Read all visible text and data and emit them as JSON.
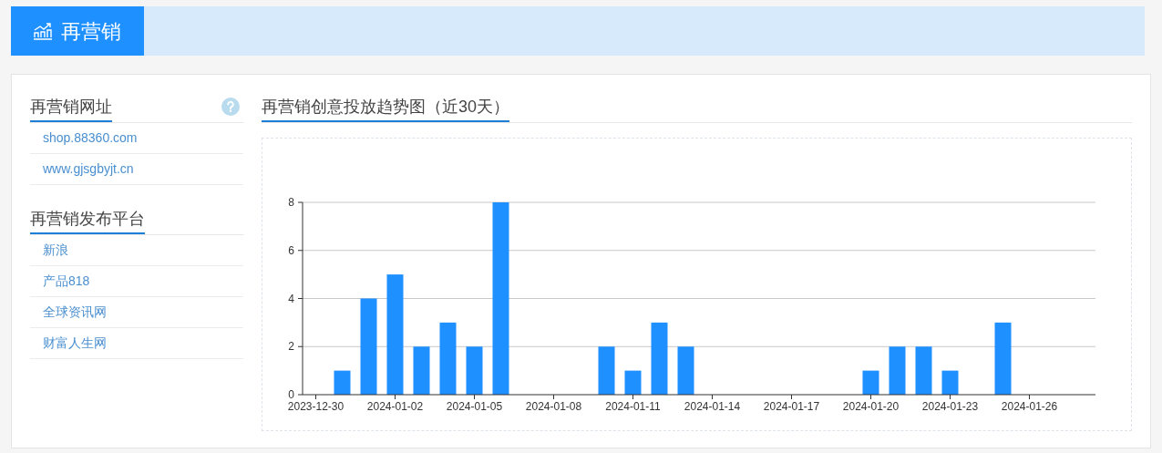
{
  "header": {
    "title": "再营销"
  },
  "sidebar": {
    "sections": [
      {
        "title": "再营销网址",
        "help": true,
        "items": [
          "shop.88360.com",
          "www.gjsgbyjt.cn"
        ]
      },
      {
        "title": "再营销发布平台",
        "help": false,
        "items": [
          "新浪",
          "产品818",
          "全球资讯网",
          "财富人生网"
        ]
      }
    ]
  },
  "chart_panel": {
    "title": "再营销创意投放趋势图（近30天）",
    "chart_data": {
      "type": "bar",
      "categories": [
        "2023-12-30",
        null,
        null,
        "2024-01-02",
        null,
        null,
        "2024-01-05",
        null,
        null,
        "2024-01-08",
        null,
        null,
        "2024-01-11",
        null,
        null,
        "2024-01-14",
        null,
        null,
        "2024-01-17",
        null,
        null,
        "2024-01-20",
        null,
        null,
        "2024-01-23",
        null,
        null,
        "2024-01-26",
        null,
        null
      ],
      "grid": true,
      "series": [
        {
          "color": "#1e90ff",
          "values": [
            0,
            1,
            4,
            5,
            2,
            3,
            2,
            8,
            0,
            0,
            0,
            2,
            1,
            3,
            2,
            0,
            0,
            0,
            0,
            0,
            0,
            1,
            2,
            2,
            1,
            0,
            3,
            0,
            0,
            0
          ]
        }
      ],
      "ylim": [
        0,
        8
      ],
      "yticks": [
        0,
        2,
        4,
        6,
        8
      ]
    }
  }
}
